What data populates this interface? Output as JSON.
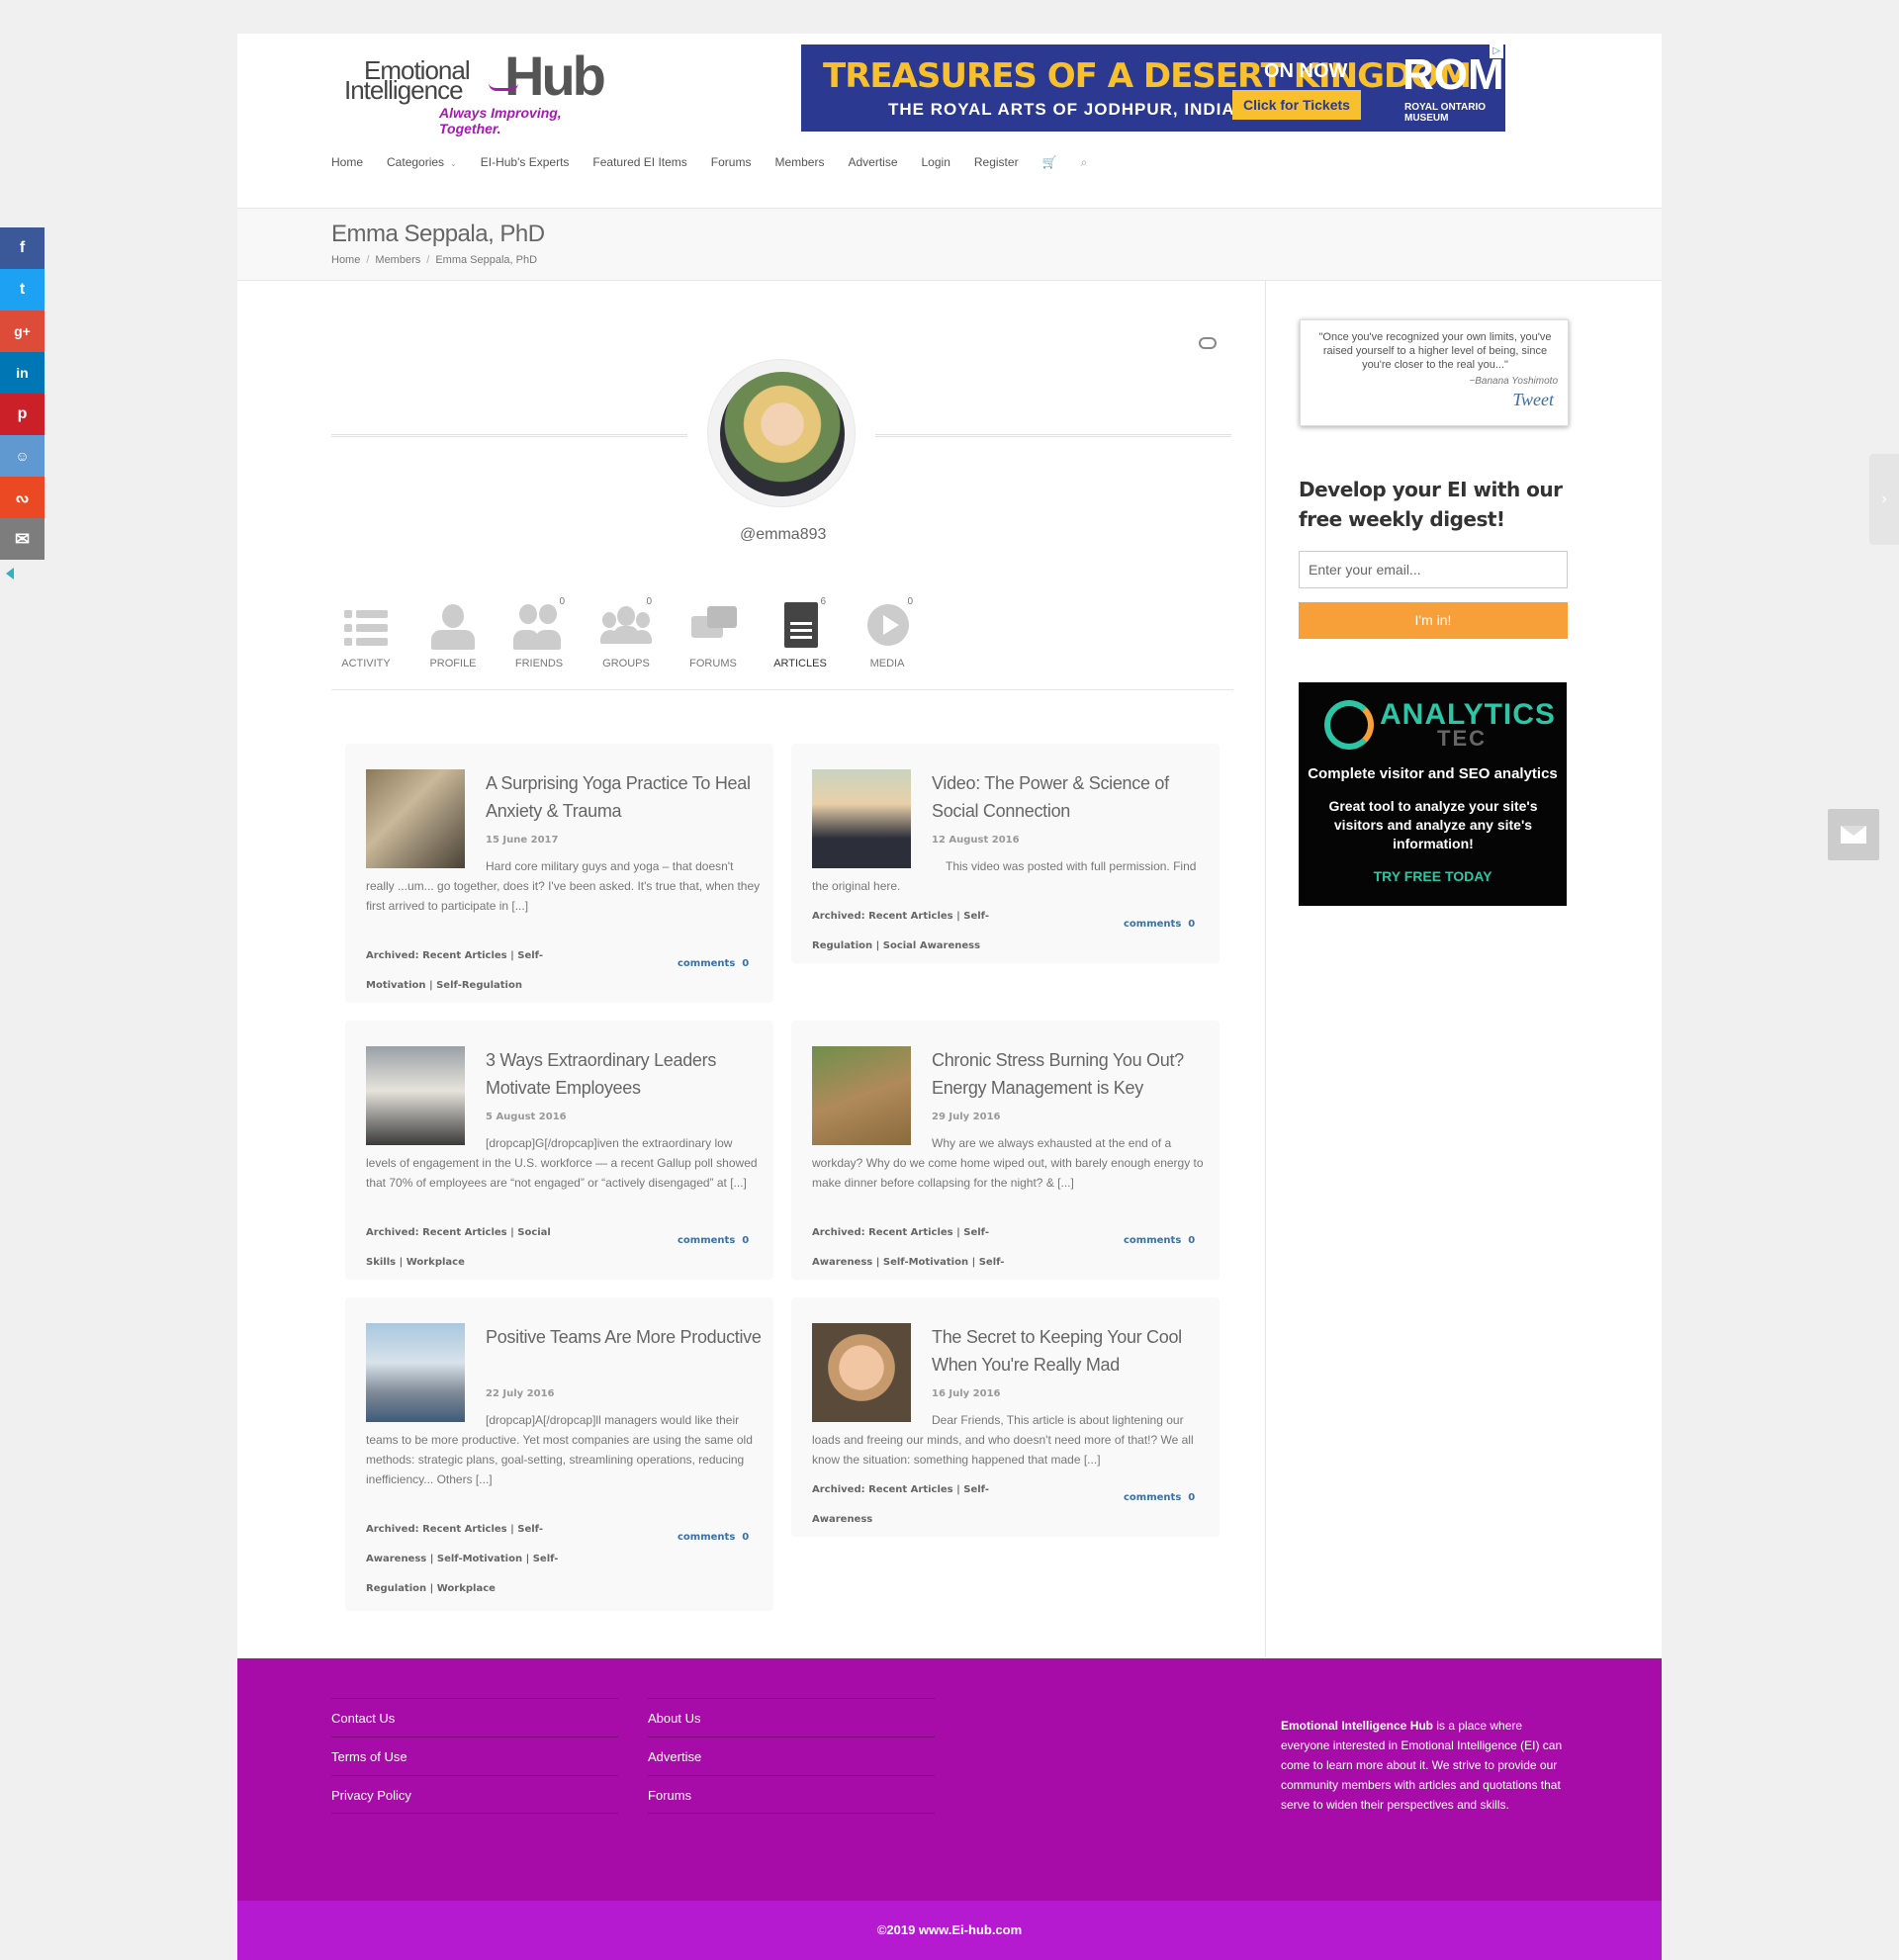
{
  "header": {
    "logo": {
      "line1": "Emotional",
      "line2": "Intelligence",
      "hub": "Hub",
      "tagline": "Always Improving, Together."
    },
    "banner_ad": {
      "title": "TREASURES OF A DESERT KINGDOM",
      "subtitle": "THE ROYAL ARTS OF JODHPUR, INDIA",
      "on_now": "ON NOW",
      "cta": "Click for Tickets",
      "brand": "ROM",
      "brand_sub": "ROYAL ONTARIO MUSEUM"
    },
    "nav": [
      "Home",
      "Categories",
      "EI-Hub's Experts",
      "Featured EI Items",
      "Forums",
      "Members",
      "Advertise",
      "Login",
      "Register"
    ]
  },
  "title_bar": {
    "title": "Emma Seppala, PhD",
    "breadcrumb": [
      "Home",
      "Members",
      "Emma Seppala, PhD"
    ]
  },
  "profile": {
    "username": "@emma893",
    "tabs": [
      {
        "label": "ACTIVITY",
        "count": ""
      },
      {
        "label": "PROFILE",
        "count": ""
      },
      {
        "label": "FRIENDS",
        "count": "0"
      },
      {
        "label": "GROUPS",
        "count": "0"
      },
      {
        "label": "FORUMS",
        "count": ""
      },
      {
        "label": "ARTICLES",
        "count": "6"
      },
      {
        "label": "MEDIA",
        "count": "0"
      }
    ]
  },
  "articles": [
    {
      "title": "A Surprising Yoga Practice To Heal Anxiety & Trauma",
      "date": "15 June 2017",
      "excerpt": "Hard core military guys and yoga – that doesn't really ...um... go together, does it? I've been asked. It's true that, when they first arrived to participate in [...]",
      "categories": "Archived: Recent Articles | Self-Motivation | Self-Regulation",
      "comments_label": "comments",
      "comments_count": "0"
    },
    {
      "title": "Video: The Power & Science of Social Connection",
      "date": "12 August 2016",
      "excerpt": "This video was posted with full permission. Find the original here.",
      "categories": "Archived: Recent Articles | Self-Regulation | Social Awareness",
      "comments_label": "comments",
      "comments_count": "0"
    },
    {
      "title": "3 Ways Extraordinary Leaders Motivate Employees",
      "date": "5 August 2016",
      "excerpt": "[dropcap]G[/dropcap]iven the extraordinary low levels of engagement in the U.S. workforce — a recent Gallup poll showed that 70% of employees are “not engaged” or “actively disengaged” at [...]",
      "categories": "Archived: Recent Articles | Social Skills | Workplace",
      "comments_label": "comments",
      "comments_count": "0"
    },
    {
      "title": "Chronic Stress Burning You Out? Energy Management is Key",
      "date": "29 July 2016",
      "excerpt": "Why are we always exhausted at the end of a workday? Why do we come home wiped out, with barely enough energy to make dinner before collapsing for the night? & [...]",
      "categories": "Archived: Recent Articles | Self-Awareness | Self-Motivation | Self-",
      "comments_label": "comments",
      "comments_count": "0"
    },
    {
      "title": "Positive Teams Are More Productive",
      "date": "22 July 2016",
      "excerpt": "[dropcap]A[/dropcap]ll managers would like their teams to be more productive. Yet most companies are using the same old methods: strategic plans, goal-setting, streamlining operations, reducing inefficiency... Others [...]",
      "categories": "Archived: Recent Articles | Self-Awareness | Self-Motivation | Self-Regulation | Workplace",
      "comments_label": "comments",
      "comments_count": "0"
    },
    {
      "title": "The Secret to Keeping Your Cool When You're Really Mad",
      "date": "16 July 2016",
      "excerpt": "Dear Friends, This article is about lightening our loads and freeing our minds, and who doesn't need more of that!? We all know the situation: something happened that made [...]",
      "categories": "Archived: Recent Articles | Self-Awareness",
      "comments_label": "comments",
      "comments_count": "0"
    }
  ],
  "sidebar": {
    "quote": {
      "text": "\"Once you've recognized your own limits, you've raised yourself to a higher level of being, since you're closer to the real you...\"",
      "author": "~Banana Yoshimoto",
      "tweet": "Tweet"
    },
    "digest_heading": "Develop your EI with our free weekly digest!",
    "email_placeholder": "Enter your email...",
    "submit_label": "I'm in!",
    "ad": {
      "brand": "ANALYTICS",
      "brand_sub": "TEC",
      "line1": "Complete visitor and SEO analytics",
      "line2": "Great tool to analyze your site's visitors and analyze any site's information!",
      "cta": "TRY FREE TODAY"
    }
  },
  "footer": {
    "col1": [
      "Contact Us",
      "Terms of Use",
      "Privacy Policy"
    ],
    "col2": [
      "About Us",
      "Advertise",
      "Forums"
    ],
    "about_bold": "Emotional Intelligence Hub",
    "about_text": " is a place where everyone interested in Emotional Intelligence (EI) can come to learn more about it. We strive to provide our community members with articles and quotations that serve to widen their perspectives and skills.",
    "copyright": "©2019 www.Ei-hub.com"
  },
  "colors": {
    "footer": "#a80ca8",
    "copybar": "#b51ad0",
    "accent_orange": "#f7a03a",
    "link_blue": "#3b6fa6"
  }
}
